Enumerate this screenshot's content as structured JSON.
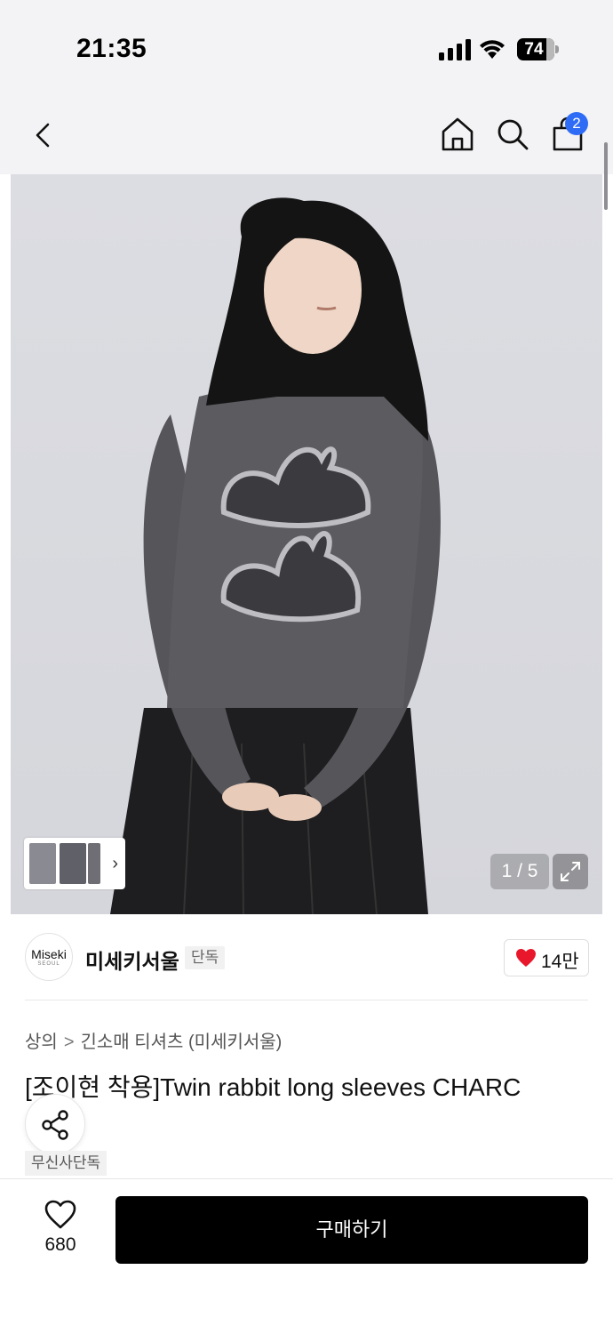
{
  "status_bar": {
    "time": "21:35",
    "battery": "74"
  },
  "nav": {
    "back_icon": "chevron-left-icon",
    "home_icon": "home-icon",
    "search_icon": "search-icon",
    "cart_icon": "shopping-bag-icon",
    "cart_badge": "2"
  },
  "gallery": {
    "page_indicator": "1 / 5",
    "expand_icon": "expand-icon",
    "thumb_arrow": "›"
  },
  "brand": {
    "logo_text": "Miseki",
    "logo_subtext": "SEOUL",
    "name": "미세키서울",
    "tag": "단독",
    "like_count": "14만"
  },
  "product": {
    "breadcrumb": [
      "상의",
      "긴소매 티셔츠 (미세키서울)"
    ],
    "breadcrumb_sep": ">",
    "title": "[조이현 착용]Twin rabbit long sleeves CHARC",
    "exclusive_tag": "무신사단독"
  },
  "bottom": {
    "wish_count": "680",
    "buy_label": "구매하기"
  },
  "colors": {
    "badge": "#2f6cf5",
    "like_heart": "#e8172b",
    "buy_button": "#000000"
  }
}
